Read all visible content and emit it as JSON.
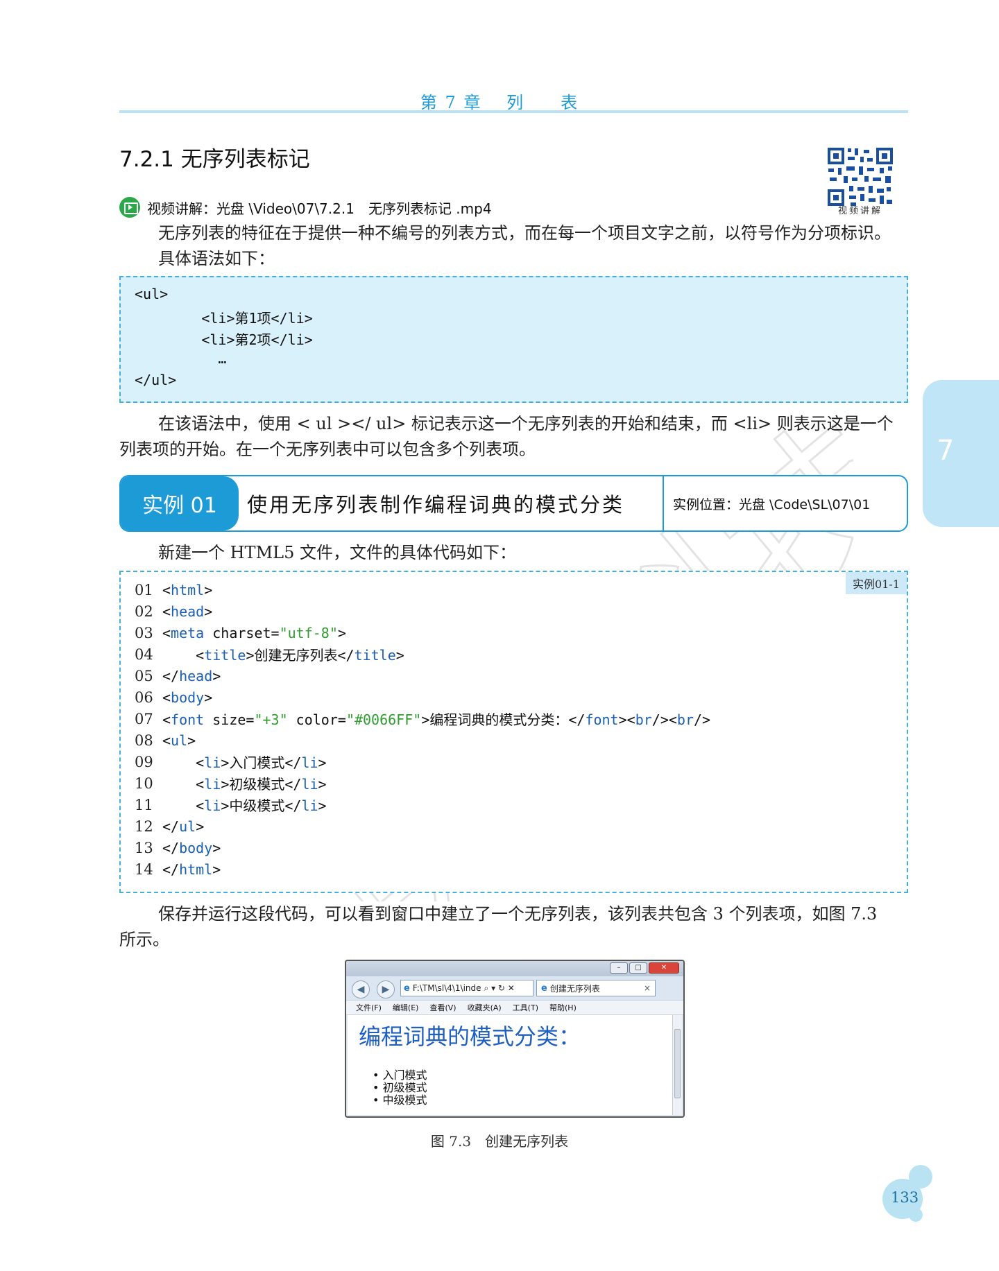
{
  "header": {
    "chapter_title": "第 7 章　 列　　表"
  },
  "section": {
    "heading": "7.2.1  无序列表标记"
  },
  "video": {
    "text": "视频讲解：光盘 \\Video\\07\\7.2.1　无序列表标记 .mp4"
  },
  "qr": {
    "caption": "视频讲解"
  },
  "para1": {
    "line1": "无序列表的特征在于提供一种不编号的列表方式，而在每一个项目文字之前，以符号作为分项标识。",
    "line2": "具体语法如下："
  },
  "syntax_box": {
    "lines": [
      "<ul>",
      "        <li>第1项</li>",
      "        <li>第2项</li>",
      "          …",
      "</ul>"
    ]
  },
  "para2": {
    "line1": "在该语法中，使用 < ul ></ ul> 标记表示这一个无序列表的开始和结束，而 <li> 则表示这是一个",
    "line2": "列表项的开始。在一个无序列表中可以包含多个列表项。"
  },
  "example": {
    "badge": "实例 01",
    "title": "使用无序列表制作编程词典的模式分类",
    "location": "实例位置：光盘 \\Code\\SL\\07\\01"
  },
  "para3": {
    "line1": "新建一个 HTML5 文件，文件的具体代码如下："
  },
  "code": {
    "label": "实例01-1",
    "lines": [
      {
        "n": "01",
        "t": "<html>"
      },
      {
        "n": "02",
        "t": "<head>"
      },
      {
        "n": "03",
        "t": "<meta charset=\"utf-8\">"
      },
      {
        "n": "04",
        "t": "    <title>创建无序列表</title>"
      },
      {
        "n": "05",
        "t": "</head>"
      },
      {
        "n": "06",
        "t": "<body>"
      },
      {
        "n": "07",
        "t": "<font size=\"+3\" color=\"#0066FF\">编程词典的模式分类：</font><br/><br/>"
      },
      {
        "n": "08",
        "t": "<ul>"
      },
      {
        "n": "09",
        "t": "    <li>入门模式</li>"
      },
      {
        "n": "10",
        "t": "    <li>初级模式</li>"
      },
      {
        "n": "11",
        "t": "    <li>中级模式</li>"
      },
      {
        "n": "12",
        "t": "</ul>"
      },
      {
        "n": "13",
        "t": "</body>"
      },
      {
        "n": "14",
        "t": "</html>"
      }
    ]
  },
  "para4": {
    "line1": "保存并运行这段代码，可以看到窗口中建立了一个无序列表，该列表共包含 3 个列表项，如图 7.3",
    "line2": "所示。"
  },
  "browser": {
    "address": "F:\\TM\\sl\\4\\1\\inde",
    "address_icons": "⌕ ▾ ↻ ✕",
    "tab_title": "创建无序列表",
    "tab_close": "×",
    "menu": [
      "文件(F)",
      "编辑(E)",
      "查看(V)",
      "收藏夹(A)",
      "工具(T)",
      "帮助(H)"
    ],
    "page_heading": "编程词典的模式分类：",
    "items": [
      "入门模式",
      "初级模式",
      "中级模式"
    ],
    "ctrl_min": "–",
    "ctrl_max": "□",
    "ctrl_close": "✕"
  },
  "figure_caption": "图 7.3　创建无序列表",
  "side_tab": {
    "number": "7"
  },
  "page_number": "133",
  "watermark": "明日科技",
  "colors": {
    "accent": "#1d9bd7",
    "code_bg": "#d9f1fb",
    "tab_bg": "#bfe5f7"
  }
}
